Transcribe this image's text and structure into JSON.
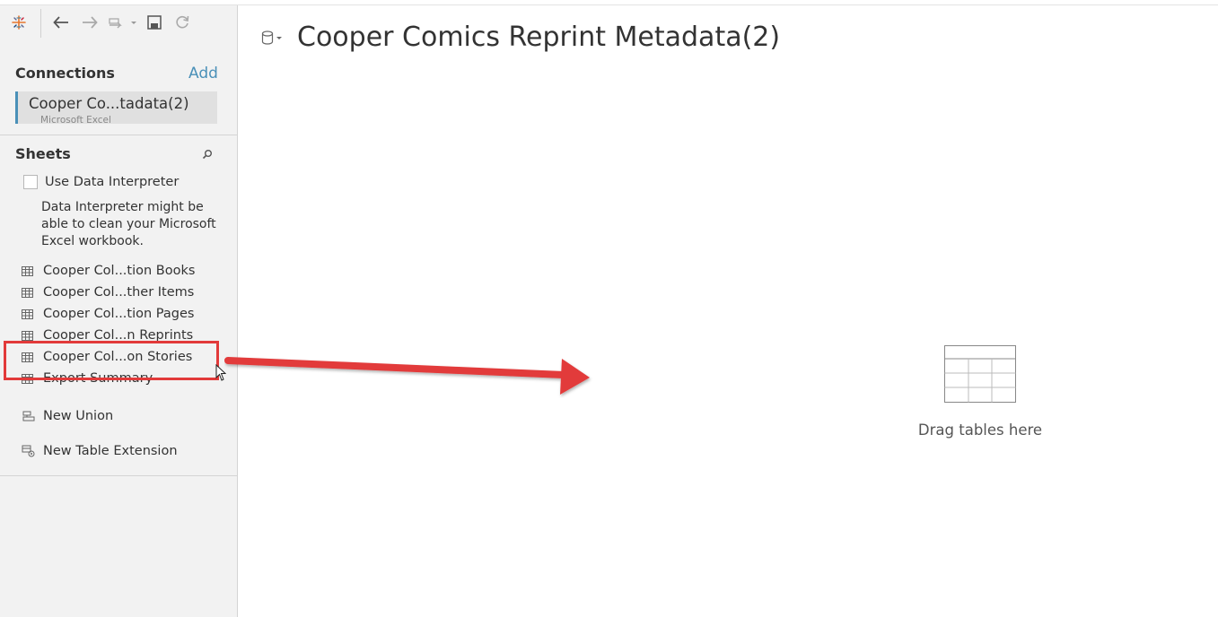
{
  "toolbar": {
    "icons": [
      "tableau-logo-icon",
      "back-arrow-icon",
      "forward-arrow-icon",
      "redo-dropdown-icon",
      "save-icon",
      "refresh-icon"
    ]
  },
  "connections": {
    "title": "Connections",
    "add_label": "Add",
    "items": [
      {
        "name": "Cooper Co...tadata(2)",
        "type": "Microsoft Excel"
      }
    ]
  },
  "sheets": {
    "title": "Sheets",
    "interpreter_label": "Use Data Interpreter",
    "interpreter_desc": "Data Interpreter might be able to clean your Microsoft Excel workbook.",
    "items": [
      {
        "label": "Cooper Col...tion Books"
      },
      {
        "label": "Cooper Col...ther Items"
      },
      {
        "label": "Cooper Col...tion Pages"
      },
      {
        "label": "Cooper Col...n Reprints"
      },
      {
        "label": "Cooper Col...on Stories"
      },
      {
        "label": "Export Summary"
      }
    ],
    "new_union_label": "New Union",
    "new_extension_label": "New Table Extension"
  },
  "main": {
    "datasource_title": "Cooper Comics Reprint Metadata(2)",
    "drop_label": "Drag tables here"
  },
  "colors": {
    "accent": "#4a90b8",
    "highlight": "#e23a3a",
    "sidebar_bg": "#f2f2f2"
  }
}
